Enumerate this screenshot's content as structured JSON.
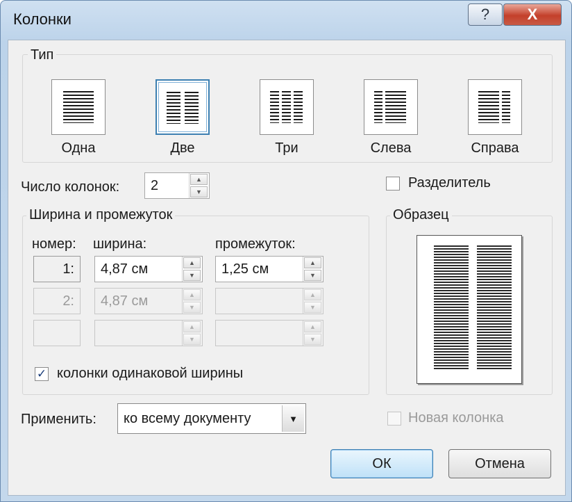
{
  "window": {
    "title": "Колонки",
    "help_glyph": "?",
    "close_glyph": "X"
  },
  "type_group": {
    "label": "Тип",
    "presets": [
      {
        "label": "Одна",
        "selected": false
      },
      {
        "label": "Две",
        "selected": true
      },
      {
        "label": "Три",
        "selected": false
      },
      {
        "label": "Слева",
        "selected": false
      },
      {
        "label": "Справа",
        "selected": false
      }
    ]
  },
  "columns_count": {
    "label": "Число колонок:",
    "value": "2"
  },
  "separator": {
    "label": "Разделитель",
    "checked": false
  },
  "width_spacing": {
    "label": "Ширина и промежуток",
    "headers": {
      "number": "номер:",
      "width": "ширина:",
      "spacing": "промежуток:"
    },
    "rows": [
      {
        "number": "1:",
        "width": "4,87 см",
        "spacing": "1,25 см",
        "enabled": true
      },
      {
        "number": "2:",
        "width": "4,87 см",
        "spacing": "",
        "enabled": false
      },
      {
        "number": "",
        "width": "",
        "spacing": "",
        "enabled": false
      }
    ],
    "equal_width": {
      "label": "колонки одинаковой ширины",
      "checked": true,
      "check_glyph": "✓"
    }
  },
  "preview": {
    "label": "Образец"
  },
  "apply": {
    "label": "Применить:",
    "value": "ко всему документу",
    "arrow_glyph": "▼"
  },
  "new_column": {
    "label": "Новая колонка",
    "checked": false,
    "enabled": false
  },
  "buttons": {
    "ok": "ОК",
    "cancel": "Отмена"
  },
  "spin_glyphs": {
    "up": "▲",
    "down": "▼"
  }
}
